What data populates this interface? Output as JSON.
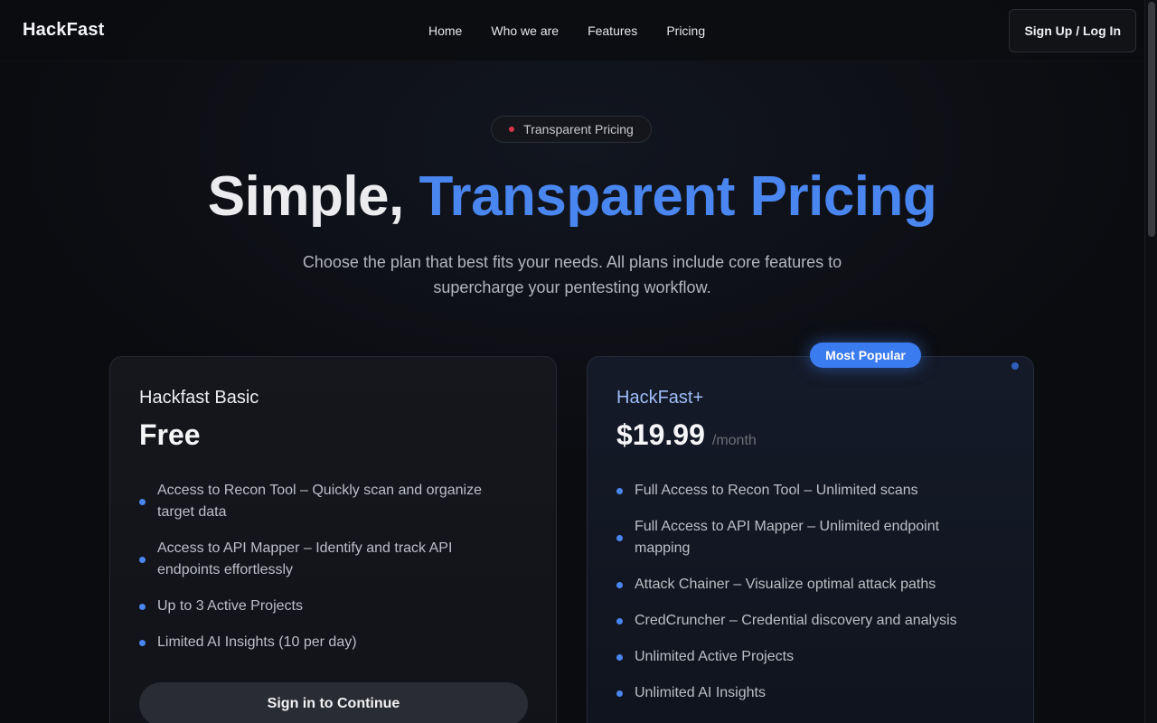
{
  "nav": {
    "brand": "HackFast",
    "links": [
      "Home",
      "Who we are",
      "Features",
      "Pricing"
    ],
    "signup_label": "Sign Up / Log In"
  },
  "hero": {
    "badge": "Transparent Pricing",
    "title_plain": "Simple, ",
    "title_accent": "Transparent Pricing",
    "subtitle": "Choose the plan that best fits your needs. All plans include core features to supercharge your pentesting workflow."
  },
  "plans": [
    {
      "name": "Hackfast Basic",
      "price": "Free",
      "period": "",
      "features": [
        "Access to Recon Tool – Quickly scan and organize target data",
        "Access to API Mapper – Identify and track API endpoints effortlessly",
        "Up to 3 Active Projects",
        "Limited AI Insights (10 per day)"
      ],
      "cta": "Sign in to Continue"
    },
    {
      "name": "HackFast+",
      "badge": "Most Popular",
      "price": "$19.99",
      "period": "/month",
      "features": [
        "Full Access to Recon Tool – Unlimited scans",
        "Full Access to API Mapper – Unlimited endpoint mapping",
        "Attack Chainer – Visualize optimal attack paths",
        "CredCruncher – Credential discovery and analysis",
        "Unlimited Active Projects",
        "Unlimited AI Insights"
      ]
    }
  ],
  "colors": {
    "accent": "#4a86f0",
    "badge_dot": "#d8344a",
    "background": "#0b0c10"
  }
}
